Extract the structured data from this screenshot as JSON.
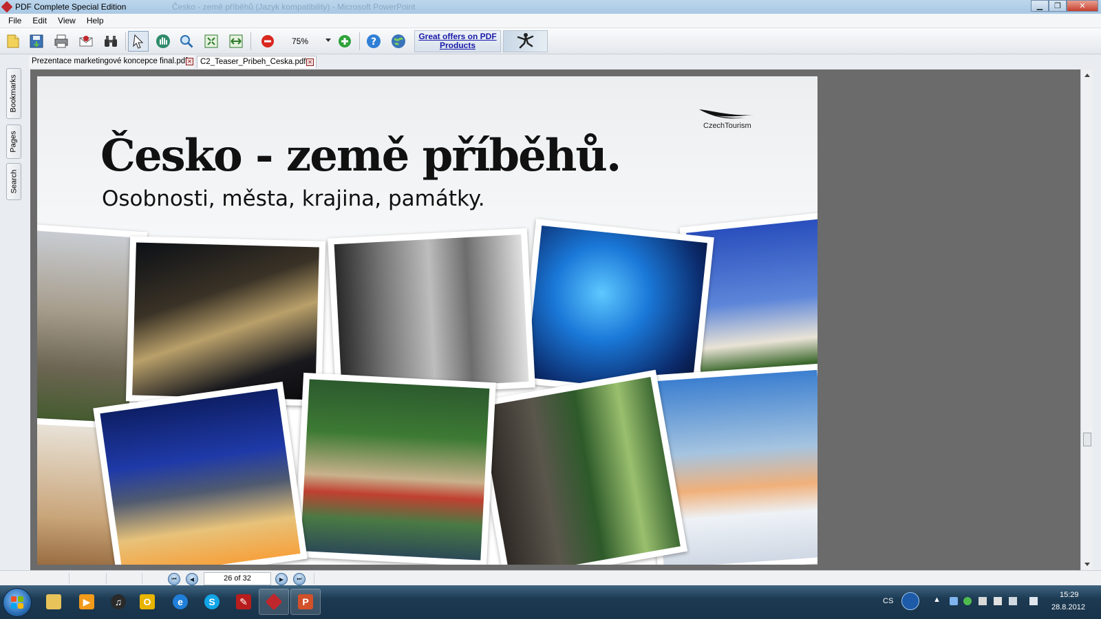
{
  "window": {
    "title": "PDF Complete Special Edition",
    "background_title": "Česko - země příběhů (Jazyk kompatibility) - Microsoft PowerPoint",
    "minimize": "▁",
    "maximize": "❐",
    "close": "✕"
  },
  "menu": [
    "File",
    "Edit",
    "View",
    "Help"
  ],
  "toolbar": {
    "zoom": "75%",
    "offer_line1": "Great offers on PDF",
    "offer_line2": "Products",
    "icons": [
      "open-icon",
      "save-icon",
      "print-icon",
      "email-icon",
      "binoculars-icon",
      "select-arrow-icon",
      "hand-tool-icon",
      "zoom-tool-icon",
      "fit-page-icon",
      "fit-width-icon",
      "zoom-out-icon",
      "zoom-in-icon",
      "help-icon",
      "globe-icon"
    ]
  },
  "tabs": [
    {
      "label": "Prezentace marketingové koncepce final.pdf"
    },
    {
      "label": "C2_Teaser_Pribeh_Ceska.pdf"
    }
  ],
  "side_tabs": [
    "Bookmarks",
    "Pages",
    "Search"
  ],
  "document": {
    "headline": "Česko - země příběhů.",
    "subline": "Osobnosti, města, krajina, památky.",
    "logo_text": "CzechTourism"
  },
  "status": {
    "page_indicator": "26 of 32"
  },
  "taskbar": {
    "language": "CS",
    "time": "15:29",
    "date": "28.8.2012",
    "apps": [
      "explorer",
      "media-player",
      "itunes",
      "outlook",
      "internet-explorer",
      "skype",
      "pdf-viewer",
      "pdf-complete",
      "powerpoint"
    ]
  },
  "colors": {
    "accent": "#1a1aa8",
    "viewer_bg": "#6b6b6b",
    "close_red": "#c7402f"
  }
}
